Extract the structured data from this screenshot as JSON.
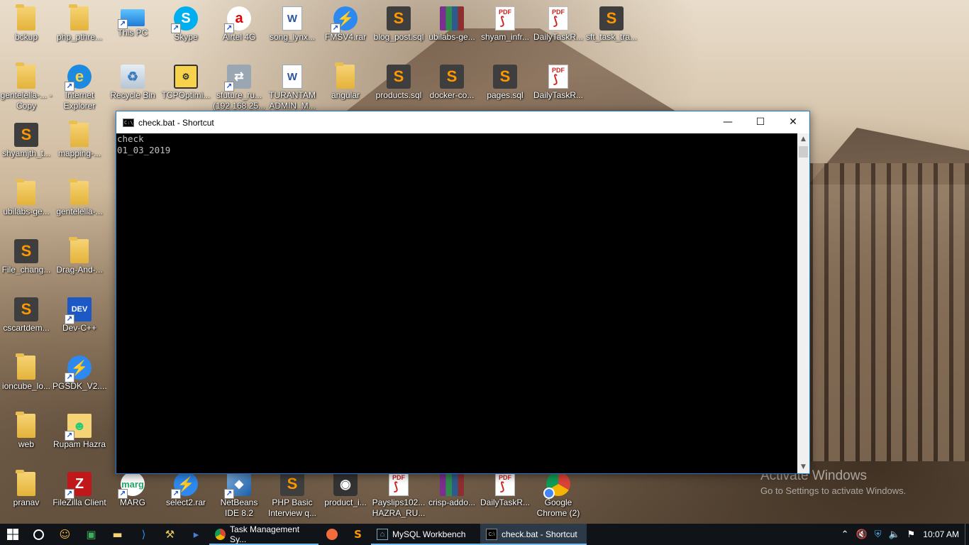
{
  "desktop": {
    "icons": [
      {
        "label": "bckup",
        "kind": "folder"
      },
      {
        "label": "php_pthre...",
        "kind": "folder"
      },
      {
        "label": "This PC",
        "kind": "pc"
      },
      {
        "label": "Skype",
        "kind": "skype"
      },
      {
        "label": "Airtel 4G",
        "kind": "airtel"
      },
      {
        "label": "song_lynx...",
        "kind": "word"
      },
      {
        "label": "FMSV4.rar",
        "kind": "flash"
      },
      {
        "label": "blog_post.sql",
        "kind": "sublime"
      },
      {
        "label": "ubilabs-ge...",
        "kind": "rar"
      },
      {
        "label": "shyam_infr...",
        "kind": "pdf"
      },
      {
        "label": "DailyTaskR...",
        "kind": "pdf"
      },
      {
        "label": "sft_task_tra...",
        "kind": "sublime"
      },
      {
        "label": "gentelella-... - Copy",
        "kind": "folder"
      },
      {
        "label": "Internet Explorer",
        "kind": "ie"
      },
      {
        "label": "Recycle Bin",
        "kind": "recycle"
      },
      {
        "label": "TCPOptimi...",
        "kind": "tcp"
      },
      {
        "label": "sfuture_ru... (192.168.25...",
        "kind": "net"
      },
      {
        "label": "TURANTAM ADMIN_M...",
        "kind": "word"
      },
      {
        "label": "angular",
        "kind": "folder"
      },
      {
        "label": "products.sql",
        "kind": "sublime"
      },
      {
        "label": "docker-co...",
        "kind": "sublime"
      },
      {
        "label": "pages.sql",
        "kind": "sublime"
      },
      {
        "label": "DailyTaskR...",
        "kind": "pdf"
      },
      {
        "label": "shyamjth_t...",
        "kind": "sublime"
      },
      {
        "label": "mapping-...",
        "kind": "folder"
      },
      {
        "label": "ubilabs-ge...",
        "kind": "folder"
      },
      {
        "label": "gentelella-...",
        "kind": "folder"
      },
      {
        "label": "File_chang...",
        "kind": "sublime"
      },
      {
        "label": "Drag-And-...",
        "kind": "folder"
      },
      {
        "label": "cscartdem...",
        "kind": "sublime"
      },
      {
        "label": "Dev-C++",
        "kind": "dev"
      },
      {
        "label": "ioncube_lo...",
        "kind": "folder"
      },
      {
        "label": "PGSDK_V2....",
        "kind": "flash"
      },
      {
        "label": "web",
        "kind": "folder"
      },
      {
        "label": "Rupam Hazra",
        "kind": "user"
      },
      {
        "label": "pranav",
        "kind": "folder"
      },
      {
        "label": "FileZilla Client",
        "kind": "fz"
      },
      {
        "label": "MARG",
        "kind": "marg"
      },
      {
        "label": "select2.rar",
        "kind": "flash"
      },
      {
        "label": "NetBeans IDE 8.2",
        "kind": "nb"
      },
      {
        "label": "PHP Basic Interview q...",
        "kind": "sublime"
      },
      {
        "label": "product_i...",
        "kind": "cam"
      },
      {
        "label": "Payslips102... HAZRA_RU...",
        "kind": "pdf"
      },
      {
        "label": "crisp-addo...",
        "kind": "rar"
      },
      {
        "label": "DailyTaskR...",
        "kind": "pdf"
      },
      {
        "label": "Google Chrome (2)",
        "kind": "chrome"
      }
    ]
  },
  "window": {
    "title": "check.bat - Shortcut",
    "console_lines": [
      "check",
      "01_03_2019"
    ],
    "minimize": "—",
    "maximize": "☐",
    "close": "✕"
  },
  "watermark": {
    "line1": "Activate Windows",
    "line2": "Go to Settings to activate Windows."
  },
  "taskbar": {
    "apps": [
      {
        "label": "Task Management Sy...",
        "icon": "chrome-icon"
      },
      {
        "label": "MySQL Workbench",
        "icon": "mysql-icon"
      },
      {
        "label": "check.bat - Shortcut",
        "icon": "cmd-icon"
      }
    ],
    "clock": "10:07 AM"
  }
}
